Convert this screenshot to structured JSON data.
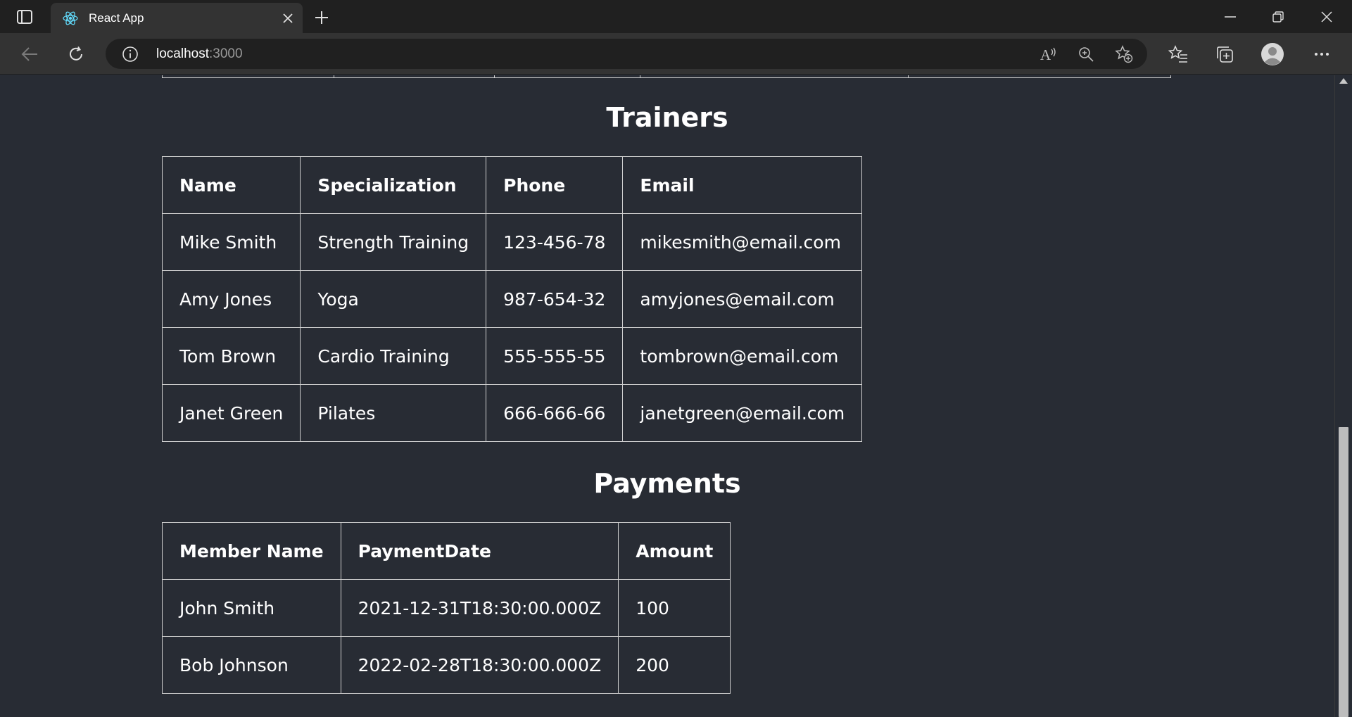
{
  "browser": {
    "tab_title": "React App",
    "url_host": "localhost",
    "url_port": ":3000"
  },
  "trainers": {
    "title": "Trainers",
    "headers": [
      "Name",
      "Specialization",
      "Phone",
      "Email"
    ],
    "rows": [
      [
        "Mike Smith",
        "Strength Training",
        "123-456-78",
        "mikesmith@email.com"
      ],
      [
        "Amy Jones",
        "Yoga",
        "987-654-32",
        "amyjones@email.com"
      ],
      [
        "Tom Brown",
        "Cardio Training",
        "555-555-55",
        "tombrown@email.com"
      ],
      [
        "Janet Green",
        "Pilates",
        "666-666-66",
        "janetgreen@email.com"
      ]
    ]
  },
  "payments": {
    "title": "Payments",
    "headers": [
      "Member Name",
      "PaymentDate",
      "Amount"
    ],
    "rows": [
      [
        "John Smith",
        "2021-12-31T18:30:00.000Z",
        "100"
      ],
      [
        "Bob Johnson",
        "2022-02-28T18:30:00.000Z",
        "200"
      ]
    ]
  },
  "icons": {
    "tab_actions": "tab-actions-icon",
    "favicon": "react-logo-icon",
    "close_tab": "close-icon",
    "new_tab": "plus-icon",
    "minimize": "minimize-icon",
    "restore": "restore-icon",
    "close_window": "close-icon",
    "back": "arrow-left-icon",
    "refresh": "refresh-icon",
    "site_info": "info-icon",
    "read_aloud": "read-aloud-icon",
    "zoom": "zoom-icon",
    "add_favorite": "star-plus-icon",
    "favorites": "favorites-icon",
    "collections": "collections-icon",
    "profile": "profile-icon",
    "menu": "more-icon"
  }
}
